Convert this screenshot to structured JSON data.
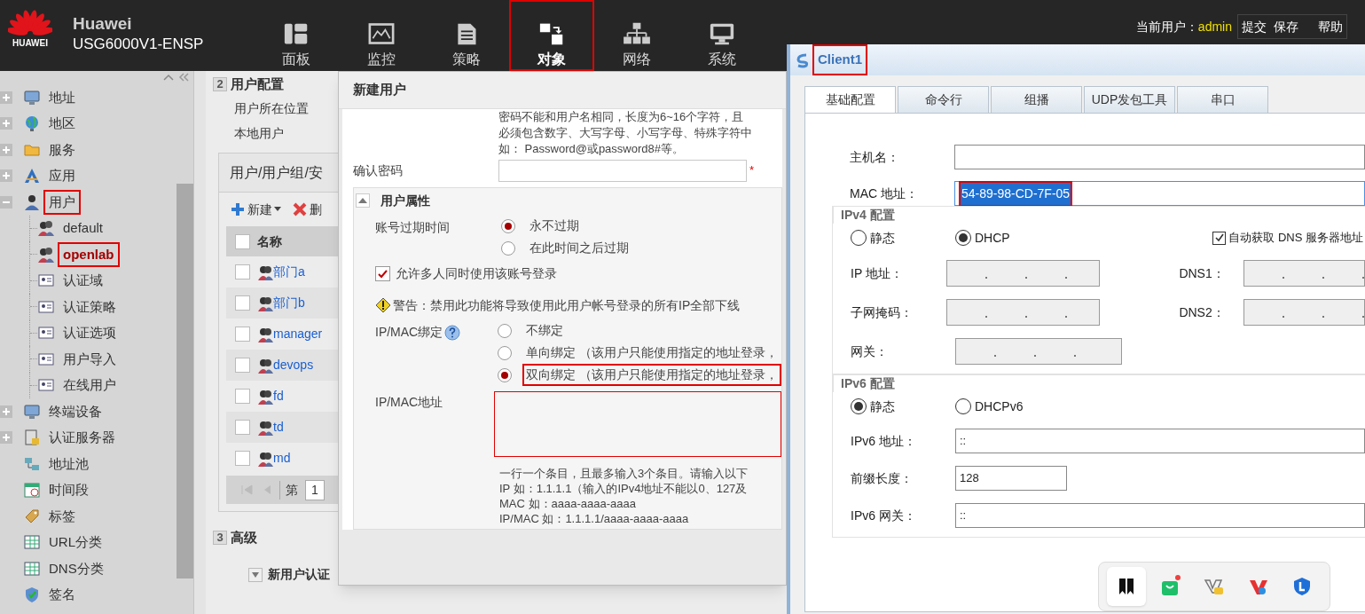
{
  "header": {
    "brand": "HUAWEI",
    "title": "Huawei",
    "model": "USG6000V1-ENSP",
    "nav": [
      {
        "label": "面板",
        "selected": false,
        "annotated": false
      },
      {
        "label": "监控",
        "selected": false,
        "annotated": false
      },
      {
        "label": "策略",
        "selected": false,
        "annotated": false
      },
      {
        "label": "对象",
        "selected": true,
        "annotated": true
      },
      {
        "label": "网络",
        "selected": false,
        "annotated": false
      },
      {
        "label": "系统",
        "selected": false,
        "annotated": false
      }
    ],
    "user_label": "当前用户：",
    "user": "admin",
    "actions": [
      "提交",
      "保存",
      "帮助"
    ]
  },
  "sidebar": {
    "items": [
      {
        "label": "地址",
        "expanded": false,
        "selected": false,
        "annotated": false
      },
      {
        "label": "地区",
        "expanded": false,
        "selected": false,
        "annotated": false
      },
      {
        "label": "服务",
        "expanded": false,
        "selected": false,
        "annotated": false
      },
      {
        "label": "应用",
        "expanded": false,
        "selected": false,
        "annotated": false
      },
      {
        "label": "用户",
        "expanded": true,
        "selected": false,
        "annotated": true,
        "children": [
          {
            "label": "default",
            "selected": false,
            "annotated": false
          },
          {
            "label": "openlab",
            "selected": true,
            "annotated": true
          },
          {
            "label": "认证域",
            "selected": false,
            "annotated": false
          },
          {
            "label": "认证策略",
            "selected": false,
            "annotated": false
          },
          {
            "label": "认证选项",
            "selected": false,
            "annotated": false
          },
          {
            "label": "用户导入",
            "selected": false,
            "annotated": false
          },
          {
            "label": "在线用户",
            "selected": false,
            "annotated": false
          }
        ]
      },
      {
        "label": "终端设备",
        "expanded": false,
        "selected": false,
        "annotated": false
      },
      {
        "label": "认证服务器",
        "expanded": false,
        "selected": false,
        "annotated": false
      },
      {
        "label": "地址池",
        "selected": false,
        "annotated": false
      },
      {
        "label": "时间段",
        "selected": false,
        "annotated": false
      },
      {
        "label": "标签",
        "selected": false,
        "annotated": false
      },
      {
        "label": "URL分类",
        "selected": false,
        "annotated": false
      },
      {
        "label": "DNS分类",
        "selected": false,
        "annotated": false
      },
      {
        "label": "签名",
        "selected": false,
        "annotated": false
      }
    ]
  },
  "main": {
    "section2": {
      "number": "2",
      "title": "用户配置",
      "rows": [
        "用户所在位置",
        "本地用户"
      ]
    },
    "list_panel": {
      "title": "用户/用户组/安",
      "select_all": {
        "checked": false
      },
      "toolbar": [
        {
          "label": "新建",
          "kind": "add"
        },
        {
          "label": "删",
          "kind": "delete"
        }
      ],
      "column": "名称",
      "rows": [
        {
          "name": "部门a",
          "checked": false
        },
        {
          "name": "部门b",
          "checked": false
        },
        {
          "name": "manager",
          "checked": false
        },
        {
          "name": "devops",
          "checked": false
        },
        {
          "name": "fd",
          "checked": false
        },
        {
          "name": "td",
          "checked": false
        },
        {
          "name": "md",
          "checked": false
        }
      ],
      "pager": {
        "label": "第",
        "page": "1"
      }
    },
    "section3": {
      "number": "3",
      "title": "高级",
      "items": [
        "新用户认证"
      ]
    }
  },
  "dialog": {
    "title": "新建用户",
    "password_hint": [
      "密码不能和用户名相同，长度为6~16个字符，且",
      "必须包含数字、大写字母、小写字母、特殊字符中",
      "如： Password@或password8#等。"
    ],
    "confirm_label": "确认密码",
    "required_mark": "*",
    "section": {
      "title": "用户属性",
      "expanded": true
    },
    "expiry": {
      "label": "账号过期时间",
      "options": [
        {
          "label": "永不过期",
          "selected": true
        },
        {
          "label": "在此时间之后过期",
          "selected": false
        }
      ]
    },
    "multi_login": {
      "label": "允许多人同时使用该账号登录",
      "checked": true
    },
    "warning": "警告：禁用此功能将导致使用此用户帐号登录的所有IP全部下线",
    "binding": {
      "label": "IP/MAC绑定",
      "options": [
        {
          "label": "不绑定",
          "selected": false,
          "annotated": false
        },
        {
          "label": "单向绑定 （该用户只能使用指定的地址登录，",
          "selected": false,
          "annotated": false
        },
        {
          "label": "双向绑定 （该用户只能使用指定的地址登录，",
          "selected": true,
          "annotated": true
        }
      ]
    },
    "address": {
      "label": "IP/MAC地址",
      "invalid": true
    },
    "address_hints": [
      "一行一个条目，且最多输入3个条目。请输入以下",
      "IP 如：1.1.1.1（输入的IPv4地址不能以0、127及",
      "MAC 如：aaaa-aaaa-aaaa",
      "IP/MAC 如：1.1.1.1/aaaa-aaaa-aaaa"
    ]
  },
  "client": {
    "title": "Client1",
    "title_annotated": true,
    "tabs": [
      {
        "label": "基础配置",
        "selected": true
      },
      {
        "label": "命令行",
        "selected": false
      },
      {
        "label": "组播",
        "selected": false
      },
      {
        "label": "UDP发包工具",
        "selected": false
      },
      {
        "label": "串口",
        "selected": false
      }
    ],
    "hostname": {
      "label": "主机名："
    },
    "mac": {
      "label": "MAC 地址：",
      "value": "54-89-98-CD-7F-05",
      "text_selected": true,
      "annotated": true
    },
    "ipv4": {
      "title": "IPv4 配置",
      "modes": [
        {
          "label": "静态",
          "selected": false
        },
        {
          "label": "DHCP",
          "selected": true
        }
      ],
      "auto_dns": {
        "label": "自动获取 DNS 服务器地址",
        "checked": true
      },
      "fields": [
        {
          "label": "IP 地址：",
          "disabled": true
        },
        {
          "label": "子网掩码：",
          "disabled": true
        },
        {
          "label": "网关：",
          "disabled": true
        }
      ],
      "dns": [
        {
          "label": "DNS1：",
          "disabled": true
        },
        {
          "label": "DNS2：",
          "disabled": true
        }
      ]
    },
    "ipv6": {
      "title": "IPv6 配置",
      "modes": [
        {
          "label": "静态",
          "selected": true
        },
        {
          "label": "DHCPv6",
          "selected": false
        }
      ],
      "fields": [
        {
          "label": "IPv6 地址：",
          "value": "::",
          "kind": "wide"
        },
        {
          "label": "前缀长度：",
          "value": "128",
          "kind": "short"
        },
        {
          "label": "IPv6 网关：",
          "value": "::",
          "kind": "wide"
        }
      ]
    }
  },
  "taskbar": {
    "apps": [
      {
        "selected": true,
        "notification": false
      },
      {
        "selected": false,
        "notification": true
      },
      {
        "selected": false,
        "notification": false
      },
      {
        "selected": false,
        "notification": false
      },
      {
        "selected": false,
        "notification": false
      }
    ]
  }
}
